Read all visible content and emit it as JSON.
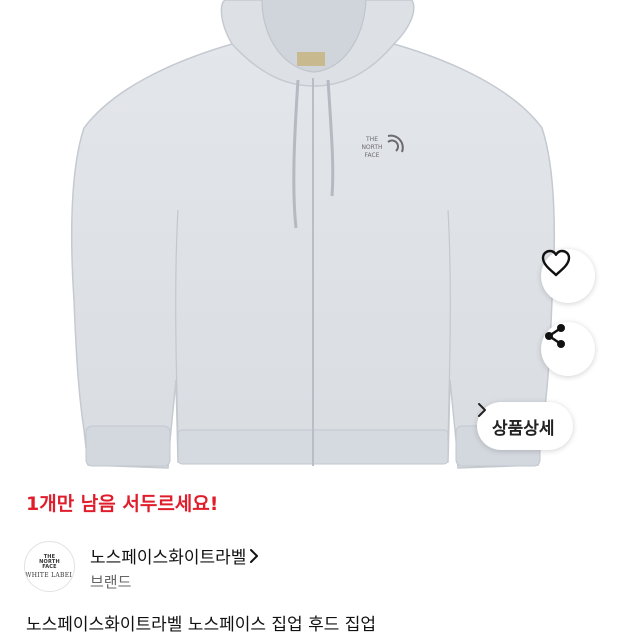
{
  "product": {
    "image_alt": "gray zip-up hoodie",
    "logo_text": "THE NORTH FACE",
    "logo_lines": [
      "THE",
      "NORTH",
      "FACE"
    ],
    "actions": {
      "like_icon": "heart-outline-icon",
      "share_icon": "share-icon",
      "detail_label": "상품상세",
      "detail_icon": "chevron-right-icon"
    },
    "stock_notice": "1개만 남음 서두르세요!",
    "brand": {
      "name": "노스페이스화이트라벨",
      "chevron": "›",
      "sub": "브랜드",
      "logo_top": [
        "THE",
        "NORTH",
        "FACE"
      ],
      "logo_text": "WHITE LABEL"
    },
    "title": "노스페이스화이트라벨 노스페이스 집업 후드 집업"
  },
  "colors": {
    "hoodie": "#dfe3e8",
    "hoodie_shadow": "#c9ced5",
    "stock_red": "#e01e2b"
  }
}
